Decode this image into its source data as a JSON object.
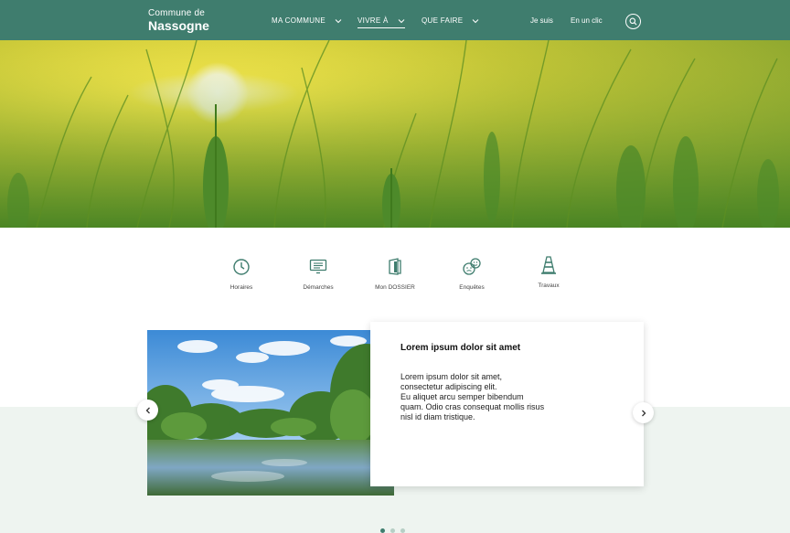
{
  "brand": {
    "line1": "Commune de",
    "line2": "Nassogne"
  },
  "nav": {
    "items": [
      {
        "label": "MA COMMUNE",
        "has_dropdown": true,
        "active": false
      },
      {
        "label": "VIVRE À",
        "has_dropdown": true,
        "active": true
      },
      {
        "label": "QUE FAIRE",
        "has_dropdown": true,
        "active": false
      }
    ],
    "links": [
      "Je suis",
      "En un clic"
    ],
    "search_icon": "search-icon"
  },
  "quick_links": [
    {
      "label": "Horaires",
      "icon": "clock-icon"
    },
    {
      "label": "Démarches",
      "icon": "form-icon"
    },
    {
      "label": "Mon DOSSIER",
      "icon": "folder-icon"
    },
    {
      "label": "Enquêtes",
      "icon": "survey-icon"
    },
    {
      "label": "Travaux",
      "icon": "traffic-cone-icon"
    }
  ],
  "slider": {
    "title": "Lorem ipsum dolor sit amet",
    "body": [
      "Lorem ipsum dolor sit amet,",
      "consectetur adipiscing elit.",
      "Eu aliquet arcu semper bibendum",
      "quam. Odio cras consequat mollis risus",
      "nisl id diam tristique."
    ],
    "prev_icon": "chevron-left-icon",
    "next_icon": "chevron-right-icon",
    "dots": 3,
    "active_dot": 1
  },
  "colors": {
    "primary": "#3f7d6e",
    "band": "#eef4f0"
  }
}
